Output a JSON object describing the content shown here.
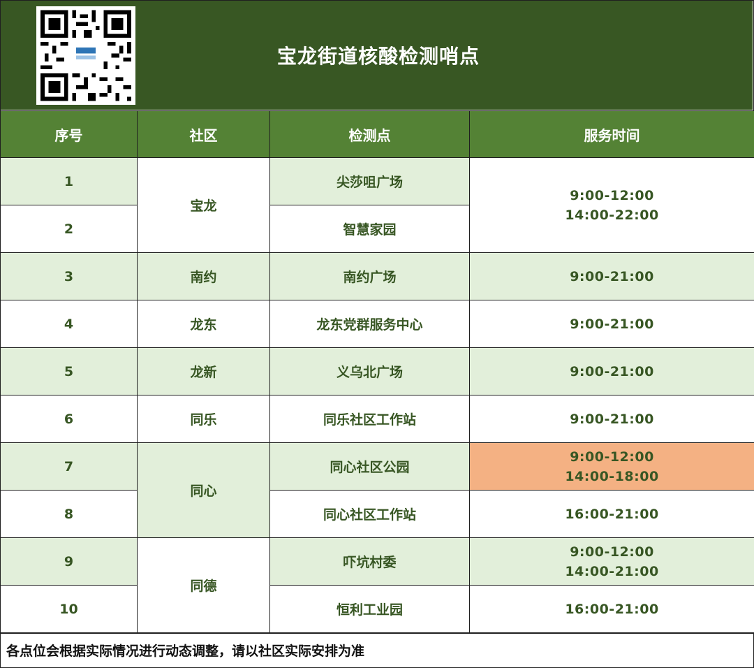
{
  "title": "宝龙街道核酸检测哨点",
  "qr_icon": "qr-code-icon",
  "headers": {
    "index": "序号",
    "community": "社区",
    "site": "检测点",
    "hours": "服务时间"
  },
  "rows": [
    {
      "index": "1",
      "community": "宝龙",
      "site": "尖莎咀广场",
      "hours": [
        "9:00-12:00",
        "14:00-22:00"
      ]
    },
    {
      "index": "2",
      "community": "宝龙",
      "site": "智慧家园",
      "hours": [
        "9:00-12:00",
        "14:00-22:00"
      ]
    },
    {
      "index": "3",
      "community": "南约",
      "site": "南约广场",
      "hours": [
        "9:00-21:00"
      ]
    },
    {
      "index": "4",
      "community": "龙东",
      "site": "龙东党群服务中心",
      "hours": [
        "9:00-21:00"
      ]
    },
    {
      "index": "5",
      "community": "龙新",
      "site": "义乌北广场",
      "hours": [
        "9:00-21:00"
      ]
    },
    {
      "index": "6",
      "community": "同乐",
      "site": "同乐社区工作站",
      "hours": [
        "9:00-21:00"
      ]
    },
    {
      "index": "7",
      "community": "同心",
      "site": "同心社区公园",
      "hours": [
        "9:00-12:00",
        "14:00-18:00"
      ]
    },
    {
      "index": "8",
      "community": "同心",
      "site": "同心社区工作站",
      "hours": [
        "16:00-21:00"
      ]
    },
    {
      "index": "9",
      "community": "同德",
      "site": "吓坑村委",
      "hours": [
        "9:00-12:00",
        "14:00-21:00"
      ]
    },
    {
      "index": "10",
      "community": "同德",
      "site": "恒利工业园",
      "hours": [
        "16:00-21:00"
      ]
    }
  ],
  "note": "各点位会根据实际情况进行动态调整，请以社区实际安排为准",
  "colors": {
    "header_bg": "#385723",
    "column_header_bg": "#548235",
    "alt_row": "#e2efda",
    "highlight": "#f4b183",
    "text": "#375623"
  }
}
